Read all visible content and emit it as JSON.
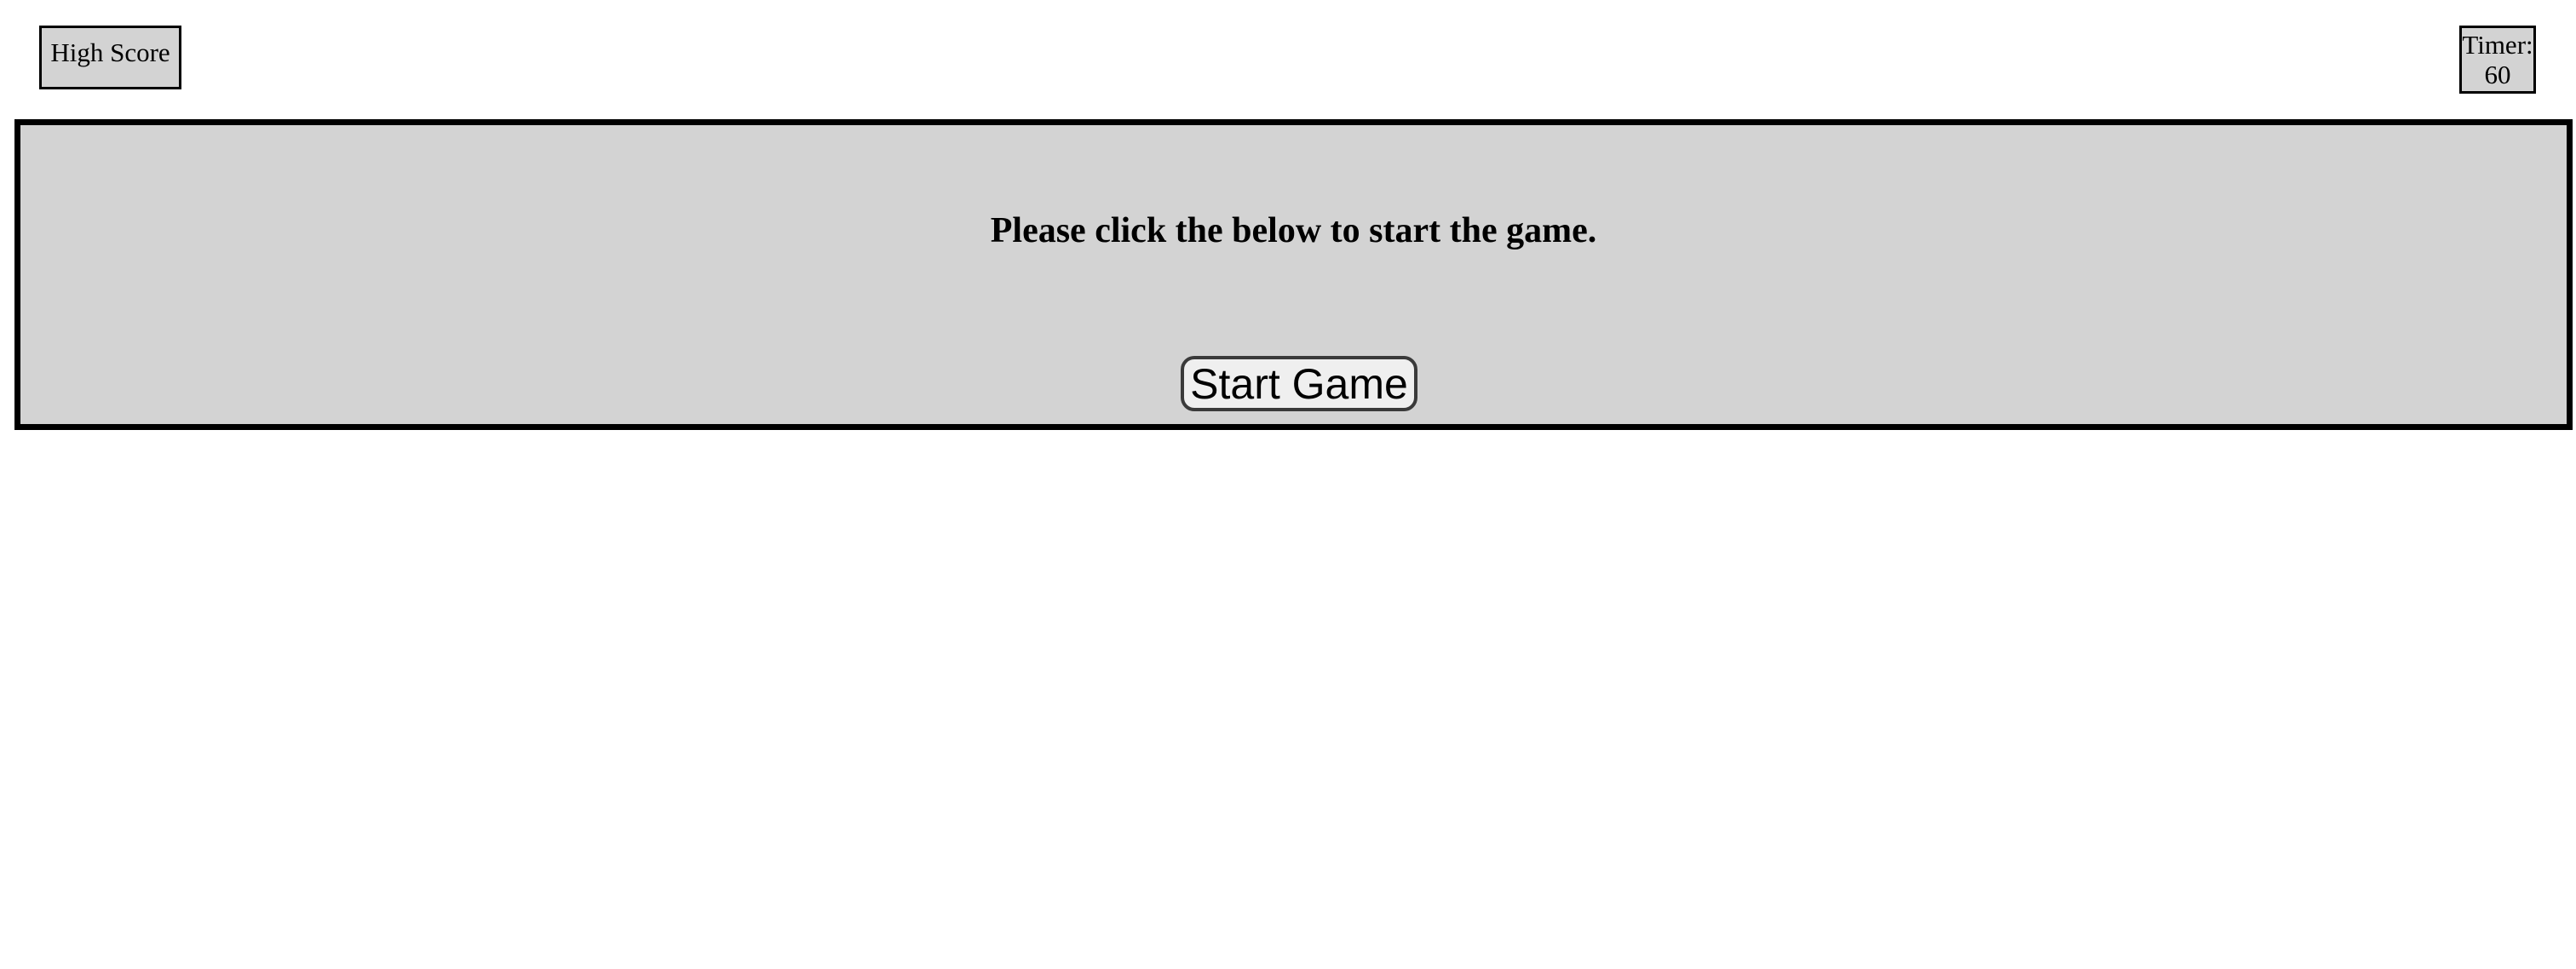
{
  "header": {
    "high_score_label": "High Score",
    "timer_label": "Timer:",
    "timer_value": "60"
  },
  "game": {
    "instruction": "Please click the below to start the game.",
    "start_button_label": "Start Game"
  },
  "colors": {
    "panel_background": "#d3d3d3",
    "border": "#000000",
    "button_background": "#efefef",
    "page_background": "#ffffff"
  }
}
